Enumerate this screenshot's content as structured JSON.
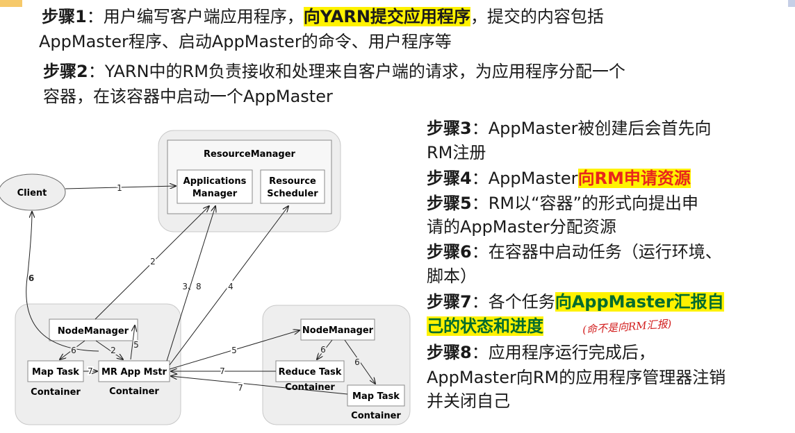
{
  "steps": {
    "s1": {
      "label": "步骤1",
      "sep": "：",
      "pre": "用户编写客户端应用程序，",
      "highlight": "向YARN提交应用程序",
      "post": "，提交的内容包括",
      "line2": "AppMaster程序、启动AppMaster的命令、用户程序等"
    },
    "s2": {
      "label": "步骤2",
      "sep": "：",
      "line1": "YARN中的RM负责接收和处理来自客户端的请求，为应用程序分配一个",
      "line2": "容器，在该容器中启动一个AppMaster"
    },
    "s3": {
      "label": "步骤3",
      "sep": "：",
      "line1": "AppMaster被创建后会首先向",
      "line2": "RM注册"
    },
    "s4": {
      "label": "步骤4",
      "sep": "：",
      "pre": "AppMaster",
      "highlight": "向RM申请资源"
    },
    "s5": {
      "label": "步骤5",
      "sep": "：",
      "line1": "RM以“容器”的形式向提出申",
      "line2": "请的AppMaster分配资源"
    },
    "s6": {
      "label": "步骤6",
      "sep": "：",
      "line1": "在容器中启动任务（运行环境、",
      "line2": "脚本）"
    },
    "s7": {
      "label": "步骤7",
      "sep": "：",
      "pre": "各个任务",
      "highlight": "向AppMaster汇报自",
      "highlight2": "己的状态和进度",
      "handwritten": "(命不是向RM汇报)"
    },
    "s8": {
      "label": "步骤8",
      "sep": "：",
      "line1": "应用程序运行完成后，",
      "line2": "AppMaster向RM的应用程序管理器注销",
      "line3": "并关闭自己"
    }
  },
  "diagram": {
    "client": "Client",
    "resource_manager": "ResourceManager",
    "apps_manager": [
      "Applications",
      "Manager"
    ],
    "scheduler": [
      "Resource",
      "Scheduler"
    ],
    "node_manager_left": "NodeManager",
    "node_manager_right": "NodeManager",
    "map_task_left": "Map Task",
    "mr_app_mstr": "MR App Mstr",
    "reduce_task": "Reduce Task",
    "map_task_right": "Map Task",
    "container_label": "Container",
    "edge_labels": {
      "e1": "1",
      "e2a": "2",
      "e38": "3、8",
      "e4": "4",
      "e6client": "6",
      "e6a": "6",
      "e2b": "2",
      "e5a": "5",
      "e7a": "7",
      "e5b": "5",
      "e7b": "7",
      "e6b": "6",
      "e6c": "6",
      "e7c": "7"
    }
  },
  "colors": {
    "highlight": "#fff200",
    "red": "#e8261c",
    "green": "#006b2e",
    "cluster": "#eeeeee",
    "box_border": "#8a8a8a"
  }
}
